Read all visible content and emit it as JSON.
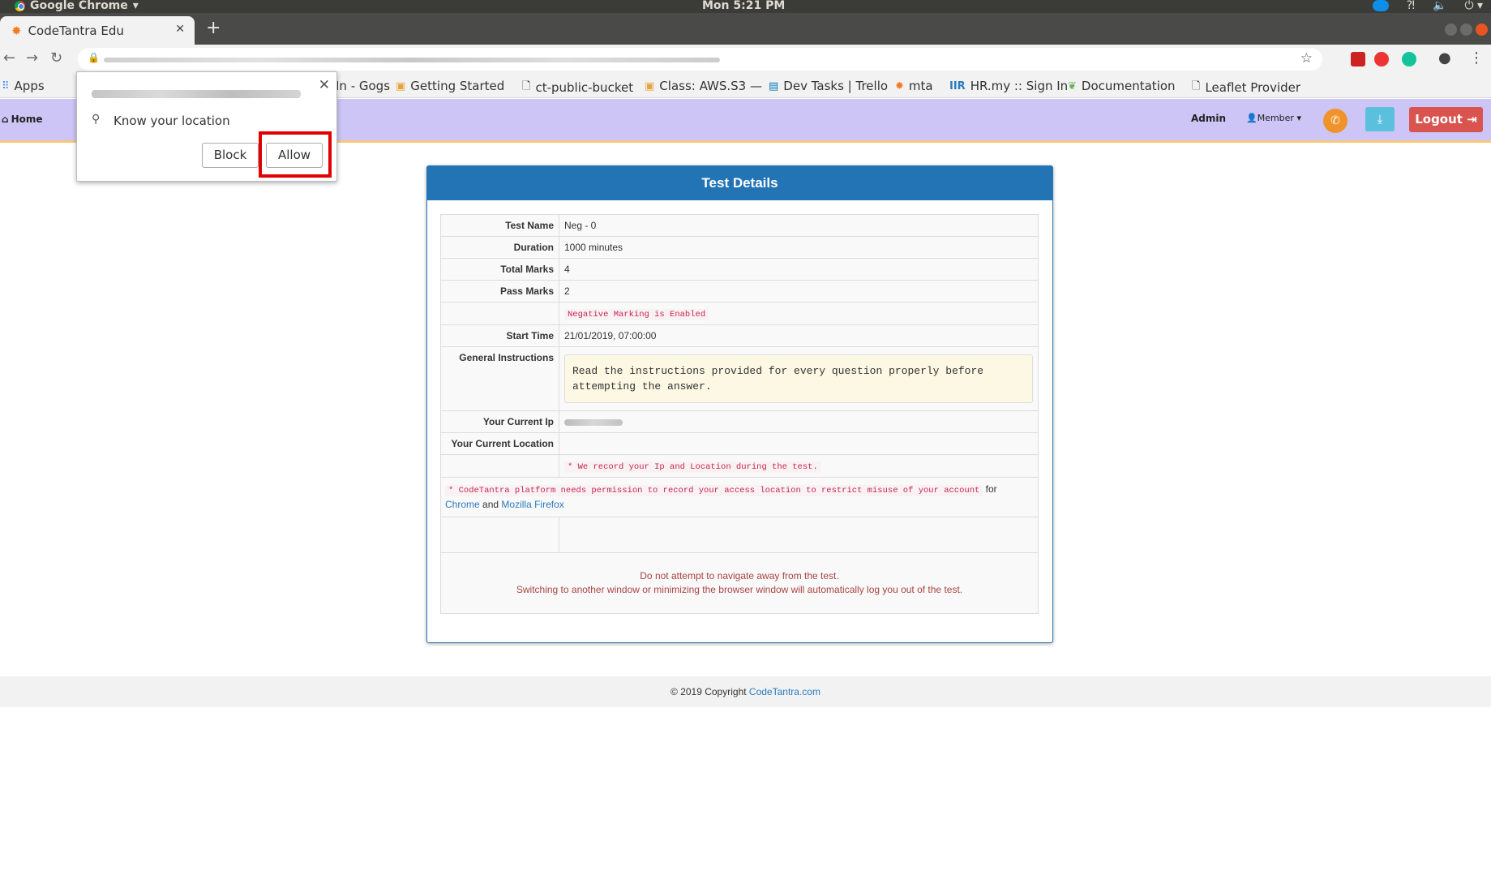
{
  "os": {
    "app_name": "Google Chrome",
    "clock": "Mon  5:21 PM"
  },
  "browser": {
    "tab_title": "CodeTantra Edu",
    "bookmarks": [
      {
        "label": "Apps",
        "icon": "apps-grid-icon"
      },
      {
        "label": "In - Gogs",
        "icon": "gogs-icon"
      },
      {
        "label": "Getting Started",
        "icon": "box-icon"
      },
      {
        "label": "ct-public-bucket",
        "icon": "page-icon"
      },
      {
        "label": "Class: AWS.S3 —",
        "icon": "box-icon"
      },
      {
        "label": "Dev Tasks | Trello",
        "icon": "trello-icon"
      },
      {
        "label": "mta",
        "icon": "gear-icon"
      },
      {
        "label": "HR.my :: Sign In",
        "icon": "hr-icon"
      },
      {
        "label": "Documentation",
        "icon": "leaf-icon"
      },
      {
        "label": "Leaflet Provider",
        "icon": "page-icon"
      }
    ]
  },
  "permission_popup": {
    "message": "Know your location",
    "block_label": "Block",
    "allow_label": "Allow"
  },
  "header": {
    "home_label": "Home",
    "admin_label": "Admin",
    "member_label": "Member",
    "logout_label": "Logout"
  },
  "test": {
    "title": "Test Details",
    "fields": {
      "name_label": "Test Name",
      "name_value": "Neg - 0",
      "duration_label": "Duration",
      "duration_value": "1000 minutes",
      "total_label": "Total Marks",
      "total_value": "4",
      "pass_label": "Pass Marks",
      "pass_value": "2",
      "neg_notice": "Negative Marking is Enabled",
      "start_label": "Start Time",
      "start_value": "21/01/2019, 07:00:00",
      "instr_label": "General Instructions",
      "instr_value": "Read the instructions provided for every question properly before attempting the answer.",
      "ip_label": "Your Current Ip",
      "location_label": "Your Current Location",
      "record_notice": "* We record your Ip and Location during the test.",
      "permission_notice": "* CodeTantra platform needs permission to record your access location to restrict misuse of your account",
      "for_text": "for",
      "chrome_link": "Chrome",
      "and_text": "and",
      "firefox_link": "Mozilla Firefox"
    },
    "warning_line1": "Do not attempt to navigate away from the test.",
    "warning_line2": "Switching to another window or minimizing the browser window will automatically log you out of the test."
  },
  "footer": {
    "copyright": "© 2019 Copyright",
    "link": "CodeTantra.com"
  },
  "colors": {
    "header_bg": "#ccc5f6",
    "card_header": "#2274b4",
    "logout": "#d9534f",
    "highlight": "#e00000"
  }
}
